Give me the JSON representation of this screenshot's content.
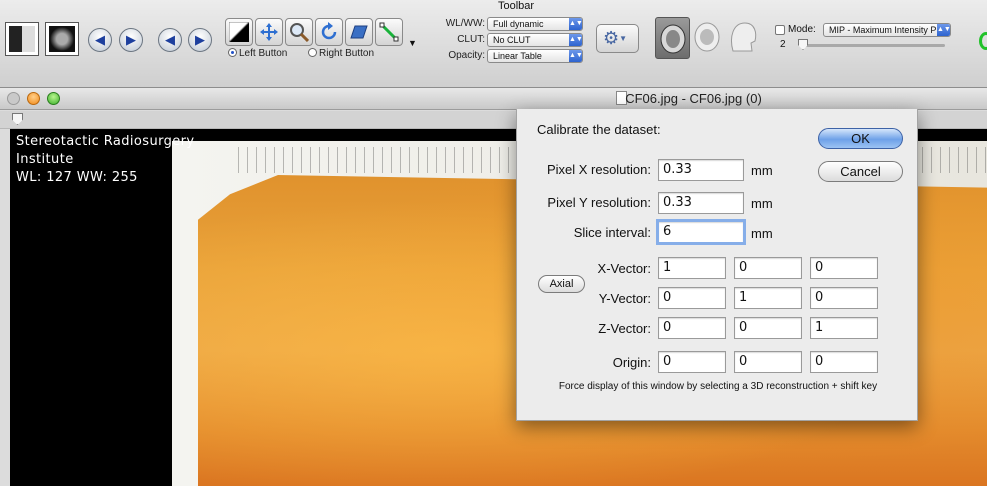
{
  "toolbar": {
    "title": "Toolbar",
    "wlww_label": "WL/WW:",
    "wlww_value": "Full dynamic",
    "clut_label": "CLUT:",
    "clut_value": "No CLUT",
    "opacity_label": "Opacity:",
    "opacity_value": "Linear Table",
    "left_button_label": "Left Button",
    "right_button_label": "Right Button",
    "mode_label": "Mode:",
    "mode_value": "MIP - Maximum Intensity Projection",
    "slab_value": "2",
    "colors": {
      "accent": "#2d63cf",
      "arrow_blue": "#1d3f9e"
    }
  },
  "window": {
    "title": "CF06.jpg - CF06.jpg (0)"
  },
  "viewer": {
    "overlay_line1": "Stereotactic Radiosurgery",
    "overlay_line2": "Institute",
    "overlay_line3": "WL: 127 WW: 255"
  },
  "dialog": {
    "heading": "Calibrate the dataset:",
    "ok_label": "OK",
    "cancel_label": "Cancel",
    "pixel_x_label": "Pixel X resolution:",
    "pixel_x_value": "0.33",
    "pixel_y_label": "Pixel Y resolution:",
    "pixel_y_value": "0.33",
    "slice_label": "Slice interval:",
    "slice_value": "6",
    "unit": "mm",
    "axial_label": "Axial",
    "x_vector_label": "X-Vector:",
    "x_vector": [
      "1",
      "0",
      "0"
    ],
    "y_vector_label": "Y-Vector:",
    "y_vector": [
      "0",
      "1",
      "0"
    ],
    "z_vector_label": "Z-Vector:",
    "z_vector": [
      "0",
      "0",
      "1"
    ],
    "origin_label": "Origin:",
    "origin": [
      "0",
      "0",
      "0"
    ],
    "footnote": "Force display of this window by selecting a 3D reconstruction + shift key"
  }
}
